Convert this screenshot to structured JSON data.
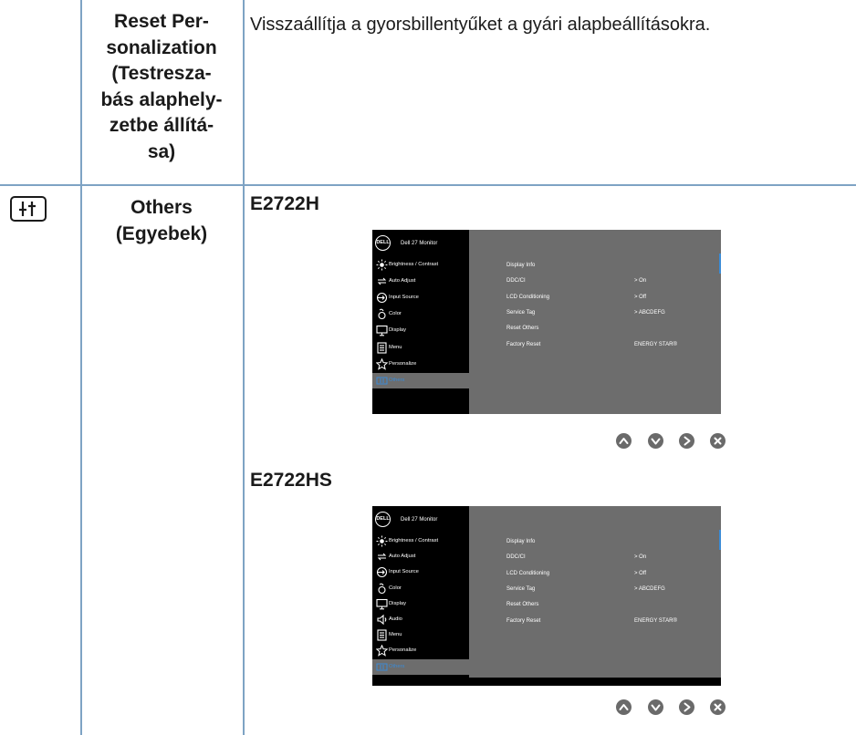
{
  "rows": [
    {
      "feature": "Reset Per-\nsonalization\n(Testresza-\nbás alaphely-\nzetbe állítá-\nsa)",
      "description": "Visszaállítja a gyorsbillentyűket a gyári alapbeállításokra."
    },
    {
      "feature": "Others\n(Egyebek)",
      "models": [
        {
          "name": "E2722H",
          "osd": {
            "logo": "DELL",
            "title": "Dell 27 Monitor",
            "menu": [
              {
                "label": "Brightness / Contrast",
                "icon": "brightness-icon"
              },
              {
                "label": "Auto Adjust",
                "icon": "auto-adjust-icon"
              },
              {
                "label": "Input Source",
                "icon": "input-source-icon"
              },
              {
                "label": "Color",
                "icon": "color-icon"
              },
              {
                "label": "Display",
                "icon": "display-icon"
              },
              {
                "label": "Menu",
                "icon": "menu-icon"
              },
              {
                "label": "Personalize",
                "icon": "star-icon"
              },
              {
                "label": "Others",
                "icon": "others-icon",
                "selected": true
              }
            ],
            "options": [
              {
                "label": "Display Info",
                "value": ""
              },
              {
                "label": "DDC/CI",
                "value": ">  On"
              },
              {
                "label": "LCD Conditioning",
                "value": ">  Off"
              },
              {
                "label": "Service Tag",
                "value": ">  ABCDEFG"
              },
              {
                "label": "Reset Others",
                "value": ""
              },
              {
                "label": "Factory Reset",
                "value": "ENERGY STAR®"
              }
            ]
          },
          "buttons": [
            "up-button",
            "down-button",
            "right-button",
            "close-button"
          ]
        },
        {
          "name": "E2722HS",
          "osd": {
            "logo": "DELL",
            "title": "Dell 27 Monitor",
            "menu": [
              {
                "label": "Brightness / Contrast",
                "icon": "brightness-icon"
              },
              {
                "label": "Auto Adjust",
                "icon": "auto-adjust-icon"
              },
              {
                "label": "Input Source",
                "icon": "input-source-icon"
              },
              {
                "label": "Color",
                "icon": "color-icon"
              },
              {
                "label": "Display",
                "icon": "display-icon"
              },
              {
                "label": "Audio",
                "icon": "audio-icon"
              },
              {
                "label": "Menu",
                "icon": "menu-icon"
              },
              {
                "label": "Personalize",
                "icon": "star-icon"
              },
              {
                "label": "Others",
                "icon": "others-icon",
                "selected": true
              }
            ],
            "options": [
              {
                "label": "Display Info",
                "value": ""
              },
              {
                "label": "DDC/CI",
                "value": ">  On"
              },
              {
                "label": "LCD Conditioning",
                "value": ">  Off"
              },
              {
                "label": "Service Tag",
                "value": ">  ABCDEFG"
              },
              {
                "label": "Reset Others",
                "value": ""
              },
              {
                "label": "Factory Reset",
                "value": "ENERGY STAR®"
              }
            ]
          },
          "buttons": [
            "up-button",
            "down-button",
            "right-button",
            "close-button"
          ]
        }
      ]
    }
  ],
  "colors": {
    "grid": "#7ea3c4",
    "osd_bg": "#000000",
    "osd_panel": "#6d6d6d",
    "accent": "#3a8bd6",
    "nav_button": "#6a6a6a"
  }
}
